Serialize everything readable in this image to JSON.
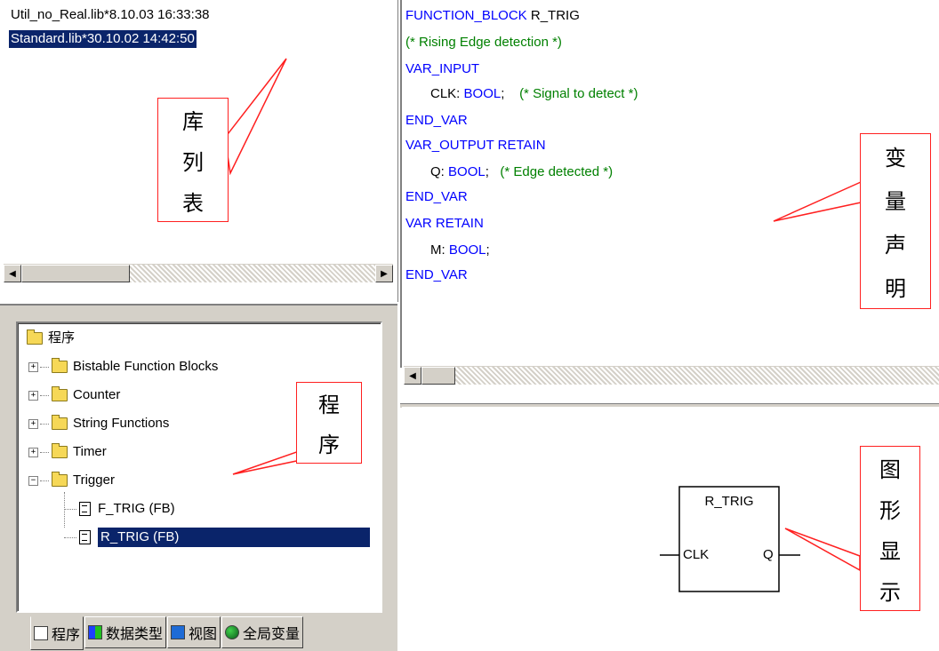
{
  "library_list": {
    "items": [
      "Util_no_Real.lib*8.10.03 16:33:38",
      "Standard.lib*30.10.02 14:42:50"
    ],
    "selected_index": 1
  },
  "tree": {
    "root_label": "程序",
    "folders": [
      {
        "label": "Bistable Function Blocks",
        "expanded": false
      },
      {
        "label": "Counter",
        "expanded": false
      },
      {
        "label": "String Functions",
        "expanded": false
      },
      {
        "label": "Timer",
        "expanded": false
      },
      {
        "label": "Trigger",
        "expanded": true
      }
    ],
    "children": [
      {
        "label": "F_TRIG (FB)",
        "selected": false
      },
      {
        "label": "R_TRIG (FB)",
        "selected": true
      }
    ]
  },
  "tabs": [
    {
      "label": "程序",
      "icon": "document-icon",
      "active": true
    },
    {
      "label": "数据类型",
      "icon": "datatype-icon",
      "active": false
    },
    {
      "label": "视图",
      "icon": "visualization-icon",
      "active": false
    },
    {
      "label": "全局变量",
      "icon": "globe-icon",
      "active": false
    }
  ],
  "code": {
    "header": "FUNCTION_BLOCK",
    "name": "R_TRIG",
    "comment": "(* Rising Edge detection *)",
    "var_input": "VAR_INPUT",
    "clk_name": "CLK:",
    "clk_type": "BOOL",
    "clk_comment": "(* Signal to detect *)",
    "end_var": "END_VAR",
    "var_output": "VAR_OUTPUT RETAIN",
    "q_name": "Q:",
    "q_type": "BOOL",
    "q_comment": "(* Edge detected *)",
    "var_retain": "VAR RETAIN",
    "m_name": "M:",
    "m_type": "BOOL"
  },
  "graphic": {
    "block_name": "R_TRIG",
    "input": "CLK",
    "output": "Q"
  },
  "annotations": {
    "library_list": [
      "库",
      "列",
      "表"
    ],
    "program": [
      "程",
      "序"
    ],
    "variable_declaration": [
      "变",
      "量",
      "声",
      "明"
    ],
    "graphic_display": [
      "图",
      "形",
      "显",
      "示"
    ]
  },
  "colors": {
    "keyword": "#0000ff",
    "comment": "#008000",
    "selection": "#0a246a",
    "callout": "#ff2020"
  }
}
